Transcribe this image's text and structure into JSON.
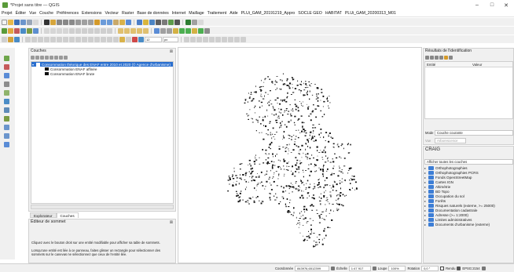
{
  "window": {
    "title": "*Projet sans titre — QGIS",
    "minimize": "–",
    "maximize": "□",
    "close": "✕"
  },
  "menu": [
    "Projet",
    "Éditer",
    "Vue",
    "Couche",
    "Préférences",
    "Extensions",
    "Vecteur",
    "Raster",
    "Base de données",
    "Internet",
    "Maillage",
    "Traitement",
    "Aide",
    "PLUi_GAM_20191219_Appro",
    "SOCLE GEO",
    "HABITAT",
    "PLUi_GAM_20200313_M01"
  ],
  "toolbar": {
    "scale_value": "12",
    "unit_value": "px"
  },
  "layers_panel": {
    "title": "Couches",
    "items": [
      {
        "label": "Consommation théorique des ENAF entre 2010 et 2020 (© Agence d'urbanisme)",
        "type": "group"
      },
      {
        "label": "Consommation ENAF affinée",
        "type": "layer"
      },
      {
        "label": "Consommation ENAF brute",
        "type": "layer"
      }
    ],
    "tabs": [
      "Explorateur",
      "Couches"
    ]
  },
  "attr_panel": {
    "title": "Éditeur de sommet",
    "text1": "Cliquez avec le bouton droit sur une entité modifiable pour afficher sa table de sommets.",
    "text2": "Lorsqu'une entité est liée à ce panneau, faites glisser un rectangle pour sélectionner des sommets sur le canevas ne sélectionnez que ceux de l'entité liée."
  },
  "ident_panel": {
    "title": "Résultats de l'identification",
    "col_entity": "Entité",
    "col_value": "Valeur",
    "mode_label": "Mode",
    "mode_value": "Couche courante",
    "view_label": "Vue",
    "view_value": "Arborescence"
  },
  "craig_panel": {
    "title": "CRAIG",
    "dropdown": "Afficher toutes les couches",
    "items": [
      "Orthophotographies",
      "Orthophotographies PCRS",
      "Fonds OpenStreetMap",
      "Cartes IGN",
      "Altimétrie",
      "BD Topo",
      "Occupation du sol",
      "Forêts",
      "Risques naturels (externe, >= 25000)",
      "Documentation cadastrale",
      "Adresse (>= 1:2000)",
      "Limites administratives",
      "Documents d'urbanisme (externe)"
    ]
  },
  "status": {
    "coord_label": "Coordonnée",
    "coord_value": "843976,6512399",
    "scale_label": "Échelle",
    "scale_value": "1:47 917",
    "loupe_label": "Loupe",
    "loupe_value": "100%",
    "rotation_label": "Rotation",
    "rotation_value": "0,0 °",
    "render_label": "Rendu",
    "crs_value": "EPSG:2154"
  },
  "colors": {
    "selection": "#2a6fcf",
    "polygon": "#111111",
    "panel": "#f0f0f0"
  }
}
